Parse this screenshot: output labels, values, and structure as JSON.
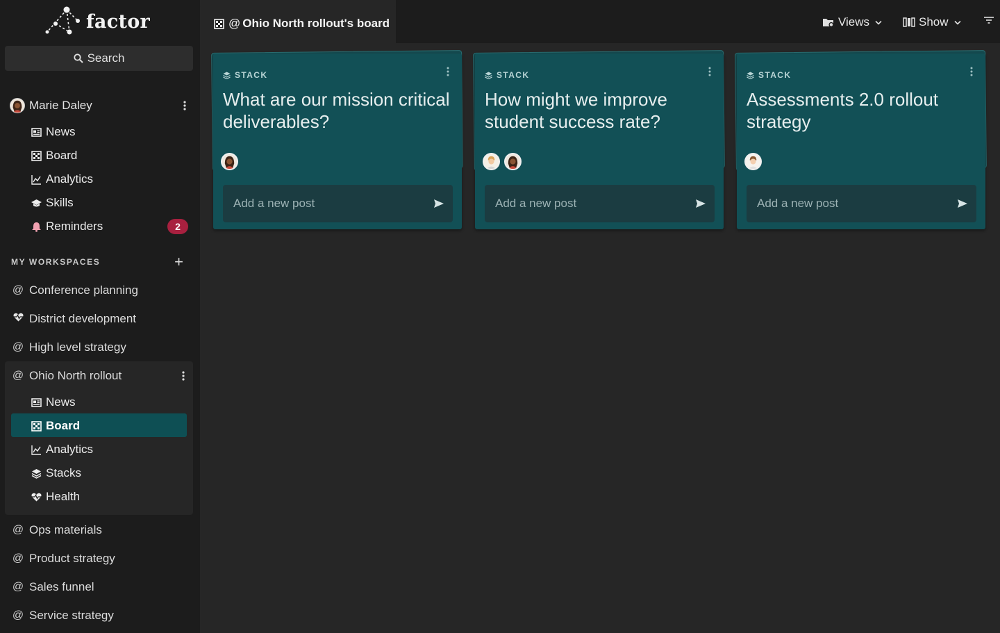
{
  "app": {
    "logo_text": "factor"
  },
  "sidebar": {
    "search_label": "Search",
    "user": {
      "name": "Marie Daley",
      "icon": "user-avatar"
    },
    "nav": [
      {
        "label": "News",
        "icon": "newspaper-icon"
      },
      {
        "label": "Board",
        "icon": "board-icon"
      },
      {
        "label": "Analytics",
        "icon": "chart-icon"
      },
      {
        "label": "Skills",
        "icon": "graduation-cap-icon"
      },
      {
        "label": "Reminders",
        "icon": "bell-icon",
        "badge": "2"
      }
    ],
    "section_title": "MY WORKSPACES",
    "workspaces": [
      {
        "label": "Conference planning",
        "icon": "at-icon"
      },
      {
        "label": "District development",
        "icon": "heart-pulse-icon"
      },
      {
        "label": "High level strategy",
        "icon": "at-icon"
      },
      {
        "label": "Ohio North rollout",
        "icon": "at-icon",
        "expanded": true
      },
      {
        "label": "Ops materials",
        "icon": "at-icon"
      },
      {
        "label": "Product strategy",
        "icon": "at-icon"
      },
      {
        "label": "Sales funnel",
        "icon": "at-icon"
      },
      {
        "label": "Service strategy",
        "icon": "at-icon"
      }
    ],
    "ohio_nav": [
      {
        "label": "News",
        "icon": "newspaper-icon"
      },
      {
        "label": "Board",
        "icon": "board-icon",
        "active": true
      },
      {
        "label": "Analytics",
        "icon": "chart-icon"
      },
      {
        "label": "Stacks",
        "icon": "stack-icon"
      },
      {
        "label": "Health",
        "icon": "heart-pulse-icon"
      }
    ]
  },
  "header": {
    "tab_at": "@",
    "tab_title": "Ohio North rollout's board",
    "views_label": "Views",
    "show_label": "Show"
  },
  "cards": [
    {
      "label": "STACK",
      "title": "What are our mission critical deliverables?",
      "placeholder": "Add a new post"
    },
    {
      "label": "STACK",
      "title": "How might we improve student success rate?",
      "placeholder": "Add a new post"
    },
    {
      "label": "STACK",
      "title": "Assessments 2.0 rollout strategy",
      "placeholder": "Add a new post"
    }
  ],
  "colors": {
    "accent": "#0e4f54",
    "card": "#125056",
    "badge": "#a8203f",
    "background": "#262626",
    "sidebar": "#1c1c1c"
  }
}
